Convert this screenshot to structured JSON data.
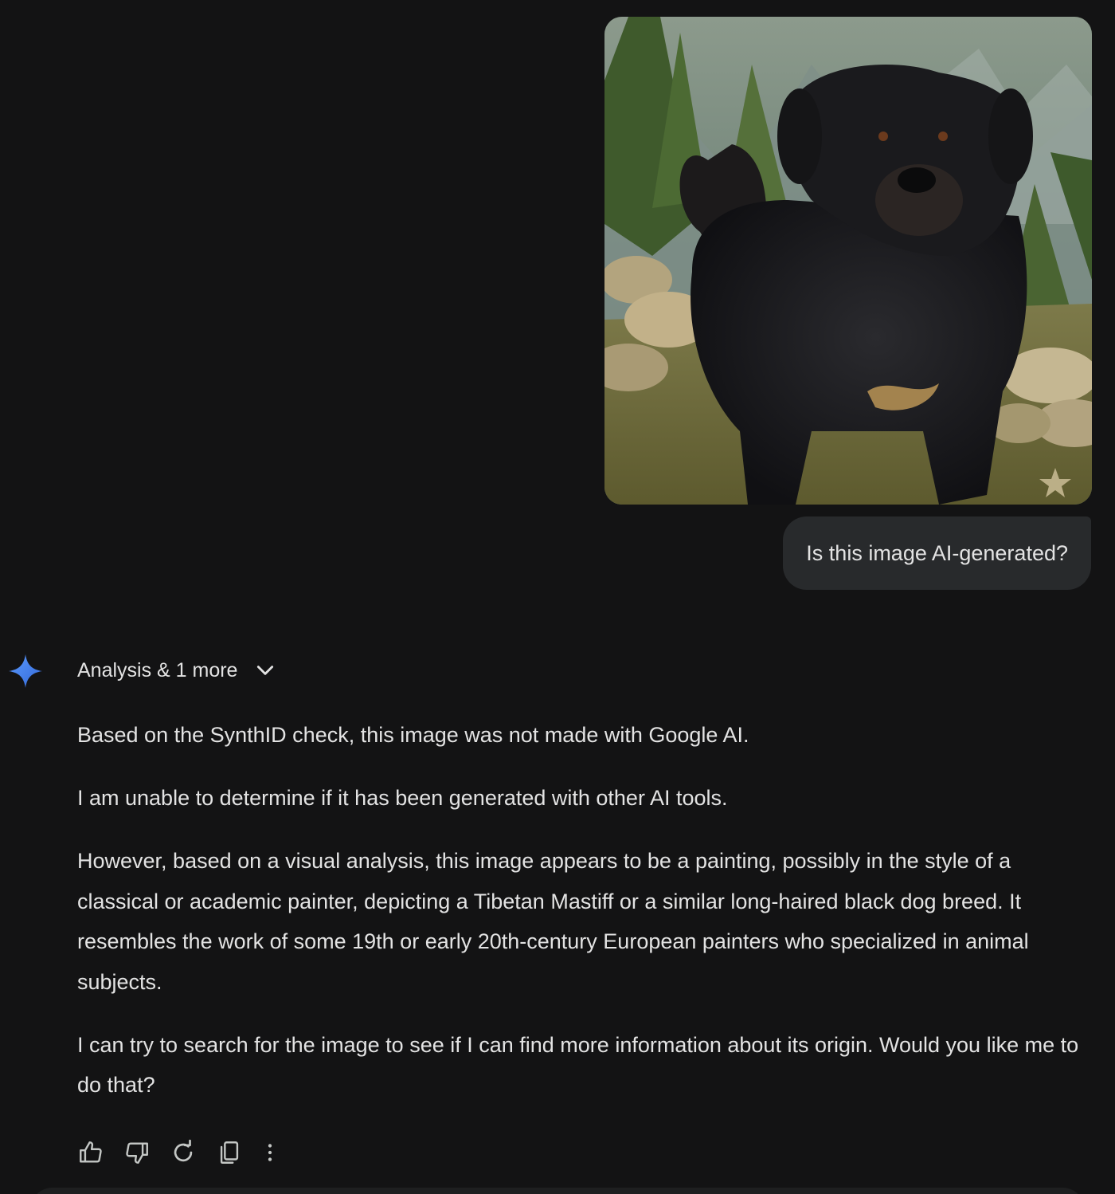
{
  "user_message": {
    "text": "Is this image AI-generated?",
    "image": {
      "subject": "painting of a black long-haired dog in a mountain landscape"
    }
  },
  "model_response": {
    "thoughts_label": "Analysis & 1 more",
    "paragraphs": [
      "Based on the SynthID check, this image was not made with Google AI.",
      "I am unable to determine if it has been generated with other AI tools.",
      "However, based on a visual analysis, this image appears to be a painting, possibly in the style of a classical or academic painter, depicting a Tibetan Mastiff or a similar long-haired black dog breed. It resembles the work of some 19th or early 20th-century European painters who specialized in animal subjects.",
      "I can try to search for the image to see if I can find more information about its origin. Would you like me to do that?"
    ]
  },
  "actions": [
    {
      "icon": "thumb-up-icon"
    },
    {
      "icon": "thumb-down-icon"
    },
    {
      "icon": "refresh-icon"
    },
    {
      "icon": "copy-icon"
    },
    {
      "icon": "more-vert-icon"
    }
  ],
  "colors": {
    "background": "#131314",
    "bubble": "#282a2c",
    "text": "#e3e3e3",
    "gemini_blue": "#4a8df8",
    "icon": "#c4c7c5"
  }
}
